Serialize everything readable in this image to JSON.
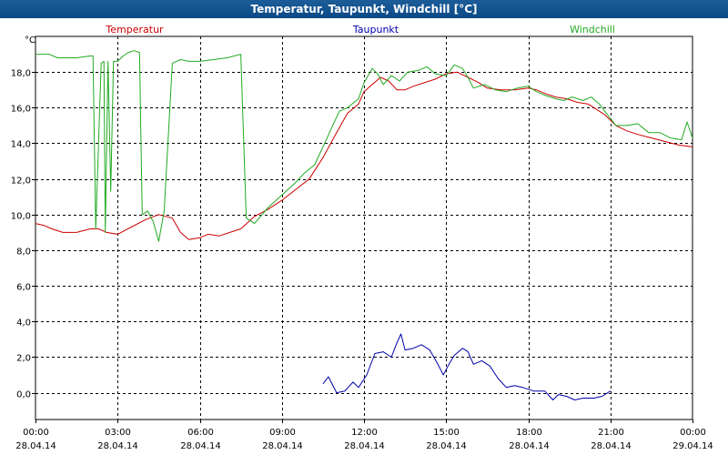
{
  "window": {
    "title": "Temperatur, Taupunkt, Windchill [°C]"
  },
  "chart_data": {
    "type": "line",
    "title": "Temperatur, Taupunkt, Windchill [°C]",
    "ylabel": "°C",
    "ylim": [
      -1.5,
      20.0
    ],
    "xlim": [
      0,
      24
    ],
    "grid": true,
    "legend_position": "top",
    "y_ticks": [
      "0,0",
      "2,0",
      "4,0",
      "6,0",
      "8,0",
      "10,0",
      "12,0",
      "14,0",
      "16,0",
      "18,0"
    ],
    "y_tick_values": [
      0,
      2,
      4,
      6,
      8,
      10,
      12,
      14,
      16,
      18
    ],
    "x_ticks": [
      {
        "time": "00:00",
        "date": "28.04.14",
        "hour": 0
      },
      {
        "time": "03:00",
        "date": "28.04.14",
        "hour": 3
      },
      {
        "time": "06:00",
        "date": "28.04.14",
        "hour": 6
      },
      {
        "time": "09:00",
        "date": "28.04.14",
        "hour": 9
      },
      {
        "time": "12:00",
        "date": "28.04.14",
        "hour": 12
      },
      {
        "time": "15:00",
        "date": "28.04.14",
        "hour": 15
      },
      {
        "time": "18:00",
        "date": "28.04.14",
        "hour": 18
      },
      {
        "time": "21:00",
        "date": "28.04.14",
        "hour": 21
      },
      {
        "time": "00:00",
        "date": "29.04.14",
        "hour": 24
      }
    ],
    "series": [
      {
        "name": "Temperatur",
        "color": "#cc0000",
        "points": [
          [
            0,
            9.5
          ],
          [
            0.3,
            9.4
          ],
          [
            0.6,
            9.2
          ],
          [
            1,
            9.0
          ],
          [
            1.5,
            9.0
          ],
          [
            2,
            9.2
          ],
          [
            2.3,
            9.2
          ],
          [
            2.6,
            9.0
          ],
          [
            3,
            8.9
          ],
          [
            3.5,
            9.3
          ],
          [
            4,
            9.7
          ],
          [
            4.5,
            10.0
          ],
          [
            5,
            9.8
          ],
          [
            5.3,
            9.0
          ],
          [
            5.6,
            8.6
          ],
          [
            6,
            8.7
          ],
          [
            6.3,
            8.9
          ],
          [
            6.7,
            8.8
          ],
          [
            7.1,
            9.0
          ],
          [
            7.5,
            9.2
          ],
          [
            8,
            9.9
          ],
          [
            8.5,
            10.3
          ],
          [
            9,
            10.8
          ],
          [
            9.5,
            11.4
          ],
          [
            10,
            12.0
          ],
          [
            10.5,
            13.2
          ],
          [
            11,
            14.6
          ],
          [
            11.4,
            15.7
          ],
          [
            11.8,
            16.2
          ],
          [
            12,
            16.9
          ],
          [
            12.3,
            17.3
          ],
          [
            12.6,
            17.7
          ],
          [
            12.9,
            17.5
          ],
          [
            13.2,
            17.0
          ],
          [
            13.5,
            17.0
          ],
          [
            13.8,
            17.2
          ],
          [
            14.2,
            17.4
          ],
          [
            14.6,
            17.6
          ],
          [
            15,
            17.9
          ],
          [
            15.4,
            18.0
          ],
          [
            15.8,
            17.7
          ],
          [
            16.2,
            17.4
          ],
          [
            16.5,
            17.1
          ],
          [
            17,
            17.0
          ],
          [
            17.5,
            17.0
          ],
          [
            18,
            17.1
          ],
          [
            18.3,
            17.0
          ],
          [
            18.6,
            16.8
          ],
          [
            19,
            16.6
          ],
          [
            19.4,
            16.5
          ],
          [
            19.8,
            16.3
          ],
          [
            20.2,
            16.2
          ],
          [
            20.5,
            15.9
          ],
          [
            20.8,
            15.6
          ],
          [
            21.2,
            15.0
          ],
          [
            21.6,
            14.7
          ],
          [
            22,
            14.5
          ],
          [
            22.5,
            14.3
          ],
          [
            23,
            14.1
          ],
          [
            23.5,
            13.9
          ],
          [
            24,
            13.8
          ]
        ]
      },
      {
        "name": "Taupunkt",
        "color": "#0000aa",
        "points": [
          [
            10.5,
            0.5
          ],
          [
            10.7,
            0.9
          ],
          [
            11,
            0.0
          ],
          [
            11.3,
            0.1
          ],
          [
            11.6,
            0.6
          ],
          [
            11.8,
            0.3
          ],
          [
            12.1,
            1.0
          ],
          [
            12.4,
            2.2
          ],
          [
            12.7,
            2.3
          ],
          [
            13.0,
            2.0
          ],
          [
            13.2,
            2.8
          ],
          [
            13.35,
            3.3
          ],
          [
            13.5,
            2.4
          ],
          [
            13.8,
            2.5
          ],
          [
            14.1,
            2.7
          ],
          [
            14.4,
            2.4
          ],
          [
            14.7,
            1.6
          ],
          [
            14.9,
            1.0
          ],
          [
            15.1,
            1.6
          ],
          [
            15.3,
            2.1
          ],
          [
            15.6,
            2.5
          ],
          [
            15.8,
            2.3
          ],
          [
            16.0,
            1.6
          ],
          [
            16.3,
            1.8
          ],
          [
            16.6,
            1.5
          ],
          [
            16.9,
            0.8
          ],
          [
            17.2,
            0.3
          ],
          [
            17.5,
            0.4
          ],
          [
            17.8,
            0.3
          ],
          [
            18.2,
            0.1
          ],
          [
            18.6,
            0.1
          ],
          [
            18.9,
            -0.4
          ],
          [
            19.1,
            -0.1
          ],
          [
            19.4,
            -0.2
          ],
          [
            19.7,
            -0.4
          ],
          [
            20.0,
            -0.3
          ],
          [
            20.4,
            -0.3
          ],
          [
            20.7,
            -0.2
          ],
          [
            21.0,
            0.1
          ]
        ]
      },
      {
        "name": "Windchill",
        "color": "#22aa22",
        "points": [
          [
            0,
            19.0
          ],
          [
            0.5,
            19.0
          ],
          [
            0.8,
            18.8
          ],
          [
            1.5,
            18.8
          ],
          [
            2.0,
            18.9
          ],
          [
            2.1,
            18.9
          ],
          [
            2.2,
            9.2
          ],
          [
            2.4,
            18.5
          ],
          [
            2.5,
            18.6
          ],
          [
            2.55,
            9.0
          ],
          [
            2.65,
            18.6
          ],
          [
            2.75,
            11.3
          ],
          [
            2.85,
            18.6
          ],
          [
            3.0,
            18.6
          ],
          [
            3.2,
            18.9
          ],
          [
            3.4,
            19.1
          ],
          [
            3.6,
            19.2
          ],
          [
            3.8,
            19.1
          ],
          [
            3.9,
            10.0
          ],
          [
            4.1,
            10.2
          ],
          [
            4.3,
            9.6
          ],
          [
            4.5,
            8.5
          ],
          [
            4.7,
            10.2
          ],
          [
            5.0,
            18.5
          ],
          [
            5.3,
            18.7
          ],
          [
            5.6,
            18.6
          ],
          [
            6.0,
            18.6
          ],
          [
            6.5,
            18.7
          ],
          [
            7.0,
            18.8
          ],
          [
            7.5,
            19.0
          ],
          [
            7.7,
            9.8
          ],
          [
            8.0,
            9.5
          ],
          [
            8.5,
            10.4
          ],
          [
            9.0,
            11.1
          ],
          [
            9.5,
            11.8
          ],
          [
            9.8,
            12.3
          ],
          [
            10.2,
            12.8
          ],
          [
            10.5,
            13.8
          ],
          [
            10.8,
            14.8
          ],
          [
            11.1,
            15.8
          ],
          [
            11.4,
            16.0
          ],
          [
            11.8,
            16.5
          ],
          [
            12.0,
            17.4
          ],
          [
            12.3,
            18.2
          ],
          [
            12.5,
            17.9
          ],
          [
            12.7,
            17.3
          ],
          [
            13.0,
            17.8
          ],
          [
            13.3,
            17.5
          ],
          [
            13.6,
            18.0
          ],
          [
            14.0,
            18.1
          ],
          [
            14.3,
            18.3
          ],
          [
            14.6,
            17.9
          ],
          [
            15.0,
            17.8
          ],
          [
            15.3,
            18.4
          ],
          [
            15.6,
            18.2
          ],
          [
            15.8,
            17.7
          ],
          [
            16.0,
            17.1
          ],
          [
            16.4,
            17.3
          ],
          [
            16.8,
            17.0
          ],
          [
            17.2,
            16.9
          ],
          [
            17.6,
            17.1
          ],
          [
            18.0,
            17.2
          ],
          [
            18.3,
            16.9
          ],
          [
            18.6,
            16.7
          ],
          [
            19.0,
            16.5
          ],
          [
            19.3,
            16.4
          ],
          [
            19.6,
            16.6
          ],
          [
            20.0,
            16.4
          ],
          [
            20.3,
            16.6
          ],
          [
            20.6,
            16.2
          ],
          [
            20.9,
            15.6
          ],
          [
            21.2,
            15.0
          ],
          [
            21.6,
            15.0
          ],
          [
            22.0,
            15.1
          ],
          [
            22.4,
            14.6
          ],
          [
            22.8,
            14.6
          ],
          [
            23.2,
            14.3
          ],
          [
            23.6,
            14.2
          ],
          [
            23.8,
            15.2
          ],
          [
            24.0,
            14.3
          ]
        ]
      }
    ]
  }
}
